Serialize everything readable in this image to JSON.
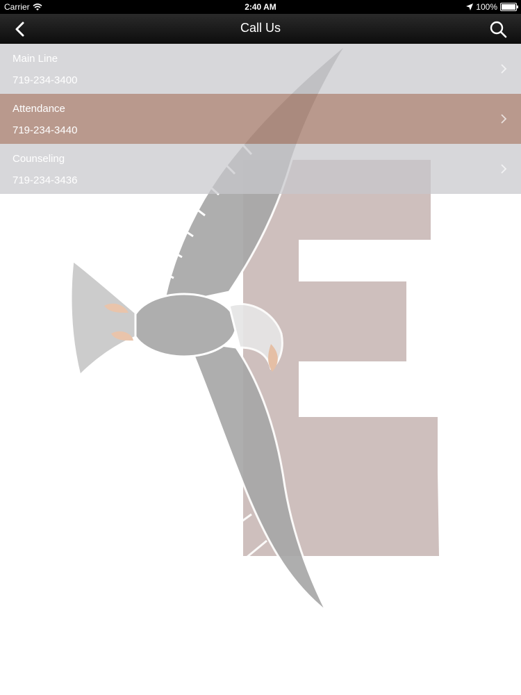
{
  "status_bar": {
    "carrier": "Carrier",
    "time": "2:40 AM",
    "battery_text": "100%",
    "battery_level": 1.0
  },
  "nav": {
    "title": "Call Us",
    "back_icon": "chevron-left-icon",
    "search_icon": "search-icon"
  },
  "contacts": [
    {
      "name": "Main Line",
      "phone": "719-234-3400",
      "selected": false
    },
    {
      "name": "Attendance",
      "phone": "719-234-3440",
      "selected": true
    },
    {
      "name": "Counseling",
      "phone": "719-234-3436",
      "selected": false
    }
  ],
  "colors": {
    "row_background": "#c8c8cc",
    "row_selected": "#aa8274",
    "nav_background": "#1a1a1a",
    "watermark_letter": "#cbbcb9",
    "watermark_eagle": "#a8a8a8"
  }
}
